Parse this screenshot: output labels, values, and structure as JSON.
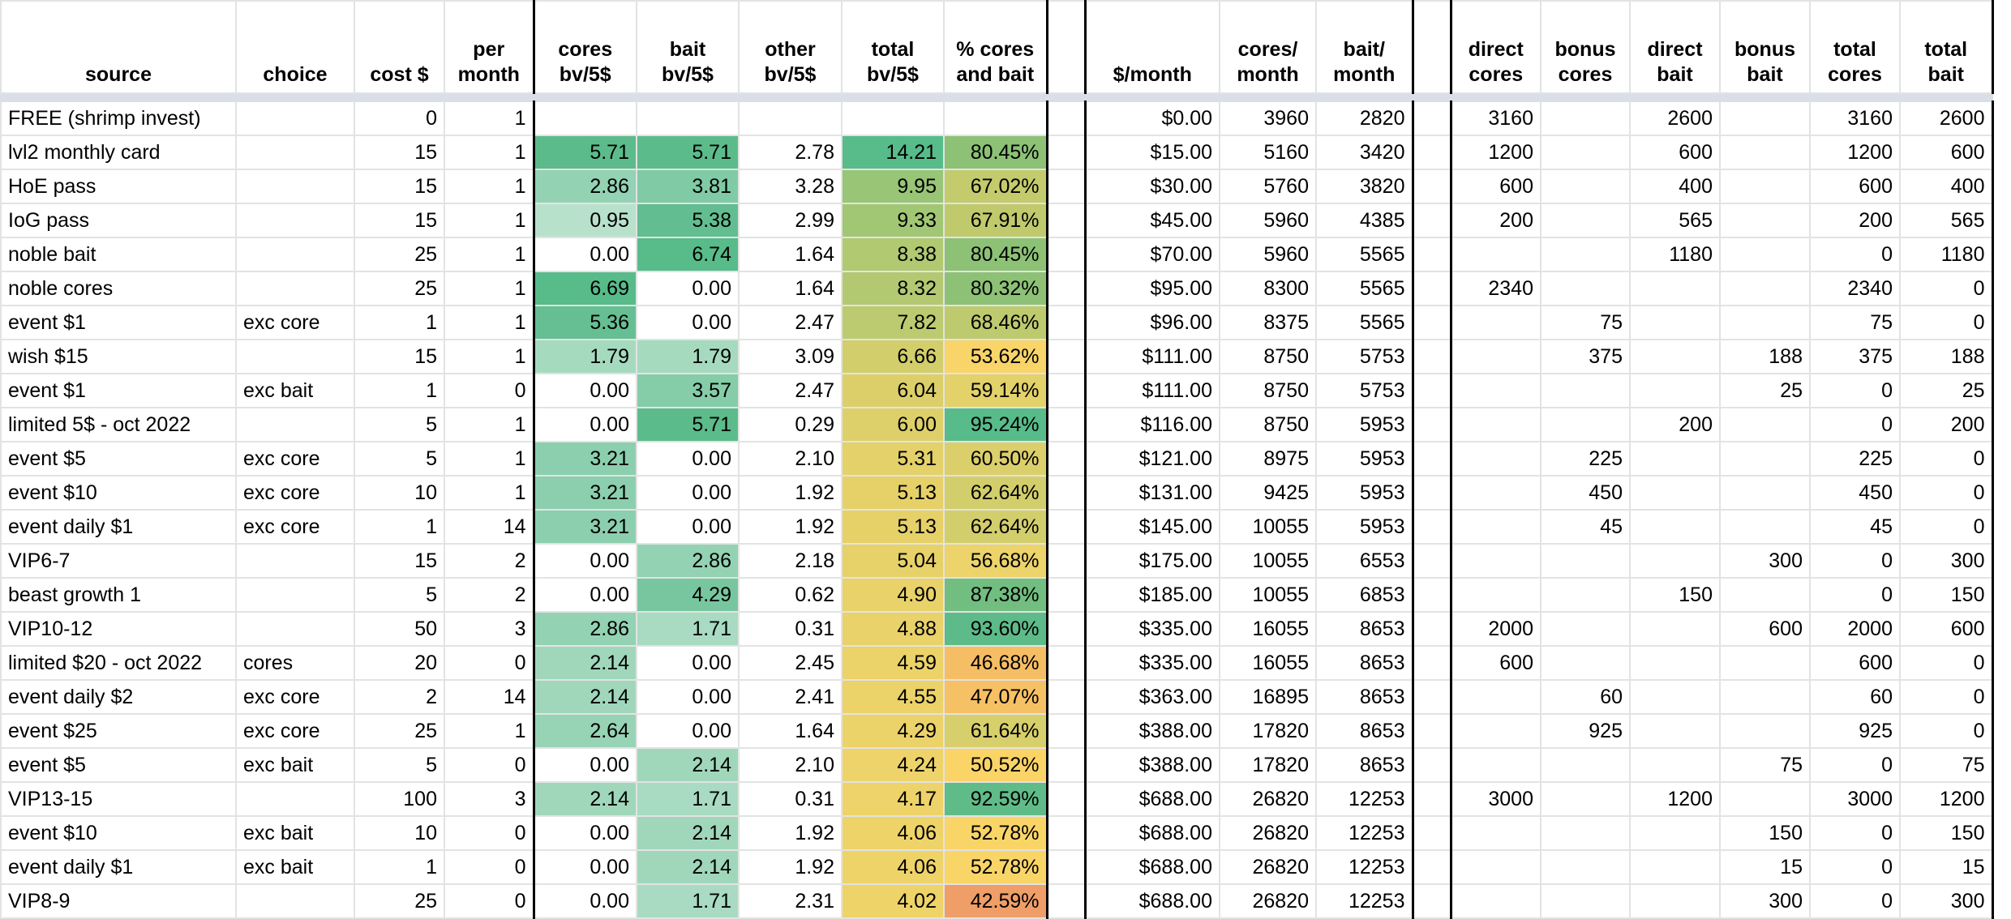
{
  "headers": {
    "source": "source",
    "choice": "choice",
    "cost": "cost $",
    "per_month": "per month",
    "cores_bv": "cores bv/5$",
    "bait_bv": "bait bv/5$",
    "other_bv": "other bv/5$",
    "total_bv": "total bv/5$",
    "pct": "% cores and bait",
    "dollar_month": "$/month",
    "cores_month": "cores/ month",
    "bait_month": "bait/ month",
    "direct_cores": "direct cores",
    "bonus_cores": "bonus cores",
    "direct_bait": "direct bait",
    "bonus_bait": "bonus bait",
    "total_cores": "total cores",
    "total_bait": "total bait"
  },
  "rows": [
    {
      "source": "FREE (shrimp invest)",
      "choice": "",
      "cost": "0",
      "per": "1",
      "cores": "",
      "bait": "",
      "other": "",
      "total": "",
      "pct": "",
      "dm": "$0.00",
      "cm": "3960",
      "bm": "2820",
      "dc": "3160",
      "bc": "",
      "db": "2600",
      "bb": "",
      "tc": "3160",
      "tb": "2600",
      "c_cores": "",
      "c_bait": "",
      "c_total": "",
      "c_pct": ""
    },
    {
      "source": "lvl2 monthly card",
      "choice": "",
      "cost": "15",
      "per": "1",
      "cores": "5.71",
      "bait": "5.71",
      "other": "2.78",
      "total": "14.21",
      "pct": "80.45%",
      "dm": "$15.00",
      "cm": "5160",
      "bm": "3420",
      "dc": "1200",
      "bc": "",
      "db": "600",
      "bb": "",
      "tc": "1200",
      "tb": "600",
      "c_cores": "#5cbb8a",
      "c_bait": "#5cbb8a",
      "c_total": "#57bb8a",
      "c_pct": "#8cc176"
    },
    {
      "source": "HoE pass",
      "choice": "",
      "cost": "15",
      "per": "1",
      "cores": "2.86",
      "bait": "3.81",
      "other": "3.28",
      "total": "9.95",
      "pct": "67.02%",
      "dm": "$30.00",
      "cm": "5760",
      "bm": "3820",
      "dc": "600",
      "bc": "",
      "db": "400",
      "bb": "",
      "tc": "600",
      "tb": "400",
      "c_cores": "#93d2b3",
      "c_bait": "#80caa6",
      "c_total": "#98c576",
      "c_pct": "#c3cb6d"
    },
    {
      "source": "IoG pass",
      "choice": "",
      "cost": "15",
      "per": "1",
      "cores": "0.95",
      "bait": "5.38",
      "other": "2.99",
      "total": "9.33",
      "pct": "67.91%",
      "dm": "$45.00",
      "cm": "5960",
      "bm": "4385",
      "dc": "200",
      "bc": "",
      "db": "565",
      "bb": "",
      "tc": "200",
      "tb": "565",
      "c_cores": "#b8e1cc",
      "c_bait": "#62be90",
      "c_total": "#a2c774",
      "c_pct": "#c0ca6d"
    },
    {
      "source": "noble bait",
      "choice": "",
      "cost": "25",
      "per": "1",
      "cores": "0.00",
      "bait": "6.74",
      "other": "1.64",
      "total": "8.38",
      "pct": "80.45%",
      "dm": "$70.00",
      "cm": "5960",
      "bm": "5565",
      "dc": "",
      "bc": "",
      "db": "1180",
      "bb": "",
      "tc": "0",
      "tb": "1180",
      "c_cores": "#ffffff",
      "c_bait": "#57bb8a",
      "c_total": "#b1c971",
      "c_pct": "#8cc176"
    },
    {
      "source": "noble cores",
      "choice": "",
      "cost": "25",
      "per": "1",
      "cores": "6.69",
      "bait": "0.00",
      "other": "1.64",
      "total": "8.32",
      "pct": "80.32%",
      "dm": "$95.00",
      "cm": "8300",
      "bm": "5565",
      "dc": "2340",
      "bc": "",
      "db": "",
      "bb": "",
      "tc": "2340",
      "tb": "0",
      "c_cores": "#57bb8a",
      "c_bait": "#ffffff",
      "c_total": "#b2c971",
      "c_pct": "#8dc176"
    },
    {
      "source": "event $1",
      "choice": "exc core",
      "cost": "1",
      "per": "1",
      "cores": "5.36",
      "bait": "0.00",
      "other": "2.47",
      "total": "7.82",
      "pct": "68.46%",
      "dm": "$96.00",
      "cm": "8375",
      "bm": "5565",
      "dc": "",
      "bc": "75",
      "db": "",
      "bb": "",
      "tc": "75",
      "tb": "0",
      "c_cores": "#65bf93",
      "c_bait": "#ffffff",
      "c_total": "#bccb6f",
      "c_pct": "#bdca6e"
    },
    {
      "source": "wish $15",
      "choice": "",
      "cost": "15",
      "per": "1",
      "cores": "1.79",
      "bait": "1.79",
      "other": "3.09",
      "total": "6.66",
      "pct": "53.62%",
      "dm": "$111.00",
      "cm": "8750",
      "bm": "5753",
      "dc": "",
      "bc": "375",
      "db": "",
      "bb": "188",
      "tc": "375",
      "tb": "188",
      "c_cores": "#a6dabf",
      "c_bait": "#a6dabf",
      "c_total": "#d2ce6b",
      "c_pct": "#f8d469"
    },
    {
      "source": "event $1",
      "choice": "exc bait",
      "cost": "1",
      "per": "0",
      "cores": "0.00",
      "bait": "3.57",
      "other": "2.47",
      "total": "6.04",
      "pct": "59.14%",
      "dm": "$111.00",
      "cm": "8750",
      "bm": "5753",
      "dc": "",
      "bc": "",
      "db": "",
      "bb": "25",
      "tc": "0",
      "tb": "25",
      "c_cores": "#ffffff",
      "c_bait": "#85cca9",
      "c_total": "#dccf6a",
      "c_pct": "#e3d16a"
    },
    {
      "source": "limited 5$ - oct 2022",
      "choice": "",
      "cost": "5",
      "per": "1",
      "cores": "0.00",
      "bait": "5.71",
      "other": "0.29",
      "total": "6.00",
      "pct": "95.24%",
      "dm": "$116.00",
      "cm": "8750",
      "bm": "5953",
      "dc": "",
      "bc": "",
      "db": "200",
      "bb": "",
      "tc": "0",
      "tb": "200",
      "c_cores": "#ffffff",
      "c_bait": "#5cbb8a",
      "c_total": "#ddd06a",
      "c_pct": "#57bb8a"
    },
    {
      "source": "event $5",
      "choice": "exc core",
      "cost": "5",
      "per": "1",
      "cores": "3.21",
      "bait": "0.00",
      "other": "2.10",
      "total": "5.31",
      "pct": "60.50%",
      "dm": "$121.00",
      "cm": "8975",
      "bm": "5953",
      "dc": "",
      "bc": "225",
      "db": "",
      "bb": "",
      "tc": "225",
      "tb": "0",
      "c_cores": "#8ccfae",
      "c_bait": "#ffffff",
      "c_total": "#e4d169",
      "c_pct": "#dbcf6b"
    },
    {
      "source": "event $10",
      "choice": "exc core",
      "cost": "10",
      "per": "1",
      "cores": "3.21",
      "bait": "0.00",
      "other": "1.92",
      "total": "5.13",
      "pct": "62.64%",
      "dm": "$131.00",
      "cm": "9425",
      "bm": "5953",
      "dc": "",
      "bc": "450",
      "db": "",
      "bb": "",
      "tc": "450",
      "tb": "0",
      "c_cores": "#8ccfae",
      "c_bait": "#ffffff",
      "c_total": "#e6d169",
      "c_pct": "#d3ce6c"
    },
    {
      "source": "event daily $1",
      "choice": "exc core",
      "cost": "1",
      "per": "14",
      "cores": "3.21",
      "bait": "0.00",
      "other": "1.92",
      "total": "5.13",
      "pct": "62.64%",
      "dm": "$145.00",
      "cm": "10055",
      "bm": "5953",
      "dc": "",
      "bc": "45",
      "db": "",
      "bb": "",
      "tc": "45",
      "tb": "0",
      "c_cores": "#8ccfae",
      "c_bait": "#ffffff",
      "c_total": "#e6d169",
      "c_pct": "#d3ce6c"
    },
    {
      "source": "VIP6-7",
      "choice": "",
      "cost": "15",
      "per": "2",
      "cores": "0.00",
      "bait": "2.86",
      "other": "2.18",
      "total": "5.04",
      "pct": "56.68%",
      "dm": "$175.00",
      "cm": "10055",
      "bm": "6553",
      "dc": "",
      "bc": "",
      "db": "",
      "bb": "300",
      "tc": "0",
      "tb": "300",
      "c_cores": "#ffffff",
      "c_bait": "#93d2b3",
      "c_total": "#e7d169",
      "c_pct": "#ecd36a"
    },
    {
      "source": "beast growth 1",
      "choice": "",
      "cost": "5",
      "per": "2",
      "cores": "0.00",
      "bait": "4.29",
      "other": "0.62",
      "total": "4.90",
      "pct": "87.38%",
      "dm": "$185.00",
      "cm": "10055",
      "bm": "6853",
      "dc": "",
      "bc": "",
      "db": "150",
      "bb": "",
      "tc": "0",
      "tb": "150",
      "c_cores": "#ffffff",
      "c_bait": "#78c6a0",
      "c_total": "#e8d269",
      "c_pct": "#72bd80"
    },
    {
      "source": "VIP10-12",
      "choice": "",
      "cost": "50",
      "per": "3",
      "cores": "2.86",
      "bait": "1.71",
      "other": "0.31",
      "total": "4.88",
      "pct": "93.60%",
      "dm": "$335.00",
      "cm": "16055",
      "bm": "8653",
      "dc": "2000",
      "bc": "",
      "db": "",
      "bb": "600",
      "tc": "2000",
      "tb": "600",
      "c_cores": "#93d2b3",
      "c_bait": "#a8dbc1",
      "c_total": "#e8d269",
      "c_pct": "#5cbb89"
    },
    {
      "source": "limited $20 - oct 2022",
      "choice": "cores",
      "cost": "20",
      "per": "0",
      "cores": "2.14",
      "bait": "0.00",
      "other": "2.45",
      "total": "4.59",
      "pct": "46.68%",
      "dm": "$335.00",
      "cm": "16055",
      "bm": "8653",
      "dc": "600",
      "bc": "",
      "db": "",
      "bb": "",
      "tc": "600",
      "tb": "0",
      "c_cores": "#a0d7bb",
      "c_bait": "#ffffff",
      "c_total": "#ebd269",
      "c_pct": "#f6be64"
    },
    {
      "source": "event daily $2",
      "choice": "exc core",
      "cost": "2",
      "per": "14",
      "cores": "2.14",
      "bait": "0.00",
      "other": "2.41",
      "total": "4.55",
      "pct": "47.07%",
      "dm": "$363.00",
      "cm": "16895",
      "bm": "8653",
      "dc": "",
      "bc": "60",
      "db": "",
      "bb": "",
      "tc": "60",
      "tb": "0",
      "c_cores": "#a0d7bb",
      "c_bait": "#ffffff",
      "c_total": "#ebd269",
      "c_pct": "#f6c064"
    },
    {
      "source": "event $25",
      "choice": "exc core",
      "cost": "25",
      "per": "1",
      "cores": "2.64",
      "bait": "0.00",
      "other": "1.64",
      "total": "4.29",
      "pct": "61.64%",
      "dm": "$388.00",
      "cm": "17820",
      "bm": "8653",
      "dc": "",
      "bc": "925",
      "db": "",
      "bb": "",
      "tc": "925",
      "tb": "0",
      "c_cores": "#97d3b5",
      "c_bait": "#ffffff",
      "c_total": "#ecd369",
      "c_pct": "#d7cf6b"
    },
    {
      "source": "event $5",
      "choice": "exc bait",
      "cost": "5",
      "per": "0",
      "cores": "0.00",
      "bait": "2.14",
      "other": "2.10",
      "total": "4.24",
      "pct": "50.52%",
      "dm": "$388.00",
      "cm": "17820",
      "bm": "8653",
      "dc": "",
      "bc": "",
      "db": "",
      "bb": "75",
      "tc": "0",
      "tb": "75",
      "c_cores": "#ffffff",
      "c_bait": "#a0d7bb",
      "c_total": "#edd369",
      "c_pct": "#fbd467"
    },
    {
      "source": "VIP13-15",
      "choice": "",
      "cost": "100",
      "per": "3",
      "cores": "2.14",
      "bait": "1.71",
      "other": "0.31",
      "total": "4.17",
      "pct": "92.59%",
      "dm": "$688.00",
      "cm": "26820",
      "bm": "12253",
      "dc": "3000",
      "bc": "",
      "db": "1200",
      "bb": "",
      "tc": "3000",
      "tb": "1200",
      "c_cores": "#a0d7bb",
      "c_bait": "#a8dbc1",
      "c_total": "#edd369",
      "c_pct": "#5fbc88"
    },
    {
      "source": "event $10",
      "choice": "exc bait",
      "cost": "10",
      "per": "0",
      "cores": "0.00",
      "bait": "2.14",
      "other": "1.92",
      "total": "4.06",
      "pct": "52.78%",
      "dm": "$688.00",
      "cm": "26820",
      "bm": "12253",
      "dc": "",
      "bc": "",
      "db": "",
      "bb": "150",
      "tc": "0",
      "tb": "150",
      "c_cores": "#ffffff",
      "c_bait": "#a0d7bb",
      "c_total": "#eed369",
      "c_pct": "#f9d568"
    },
    {
      "source": "event daily $1",
      "choice": "exc bait",
      "cost": "1",
      "per": "0",
      "cores": "0.00",
      "bait": "2.14",
      "other": "1.92",
      "total": "4.06",
      "pct": "52.78%",
      "dm": "$688.00",
      "cm": "26820",
      "bm": "12253",
      "dc": "",
      "bc": "",
      "db": "",
      "bb": "15",
      "tc": "0",
      "tb": "15",
      "c_cores": "#ffffff",
      "c_bait": "#a0d7bb",
      "c_total": "#eed369",
      "c_pct": "#f9d568"
    },
    {
      "source": "VIP8-9",
      "choice": "",
      "cost": "25",
      "per": "0",
      "cores": "0.00",
      "bait": "1.71",
      "other": "2.31",
      "total": "4.02",
      "pct": "42.59%",
      "dm": "$688.00",
      "cm": "26820",
      "bm": "12253",
      "dc": "",
      "bc": "",
      "db": "",
      "bb": "300",
      "tc": "0",
      "tb": "300",
      "c_cores": "#ffffff",
      "c_bait": "#a8dbc1",
      "c_total": "#eed369",
      "c_pct": "#ef9e68"
    }
  ]
}
